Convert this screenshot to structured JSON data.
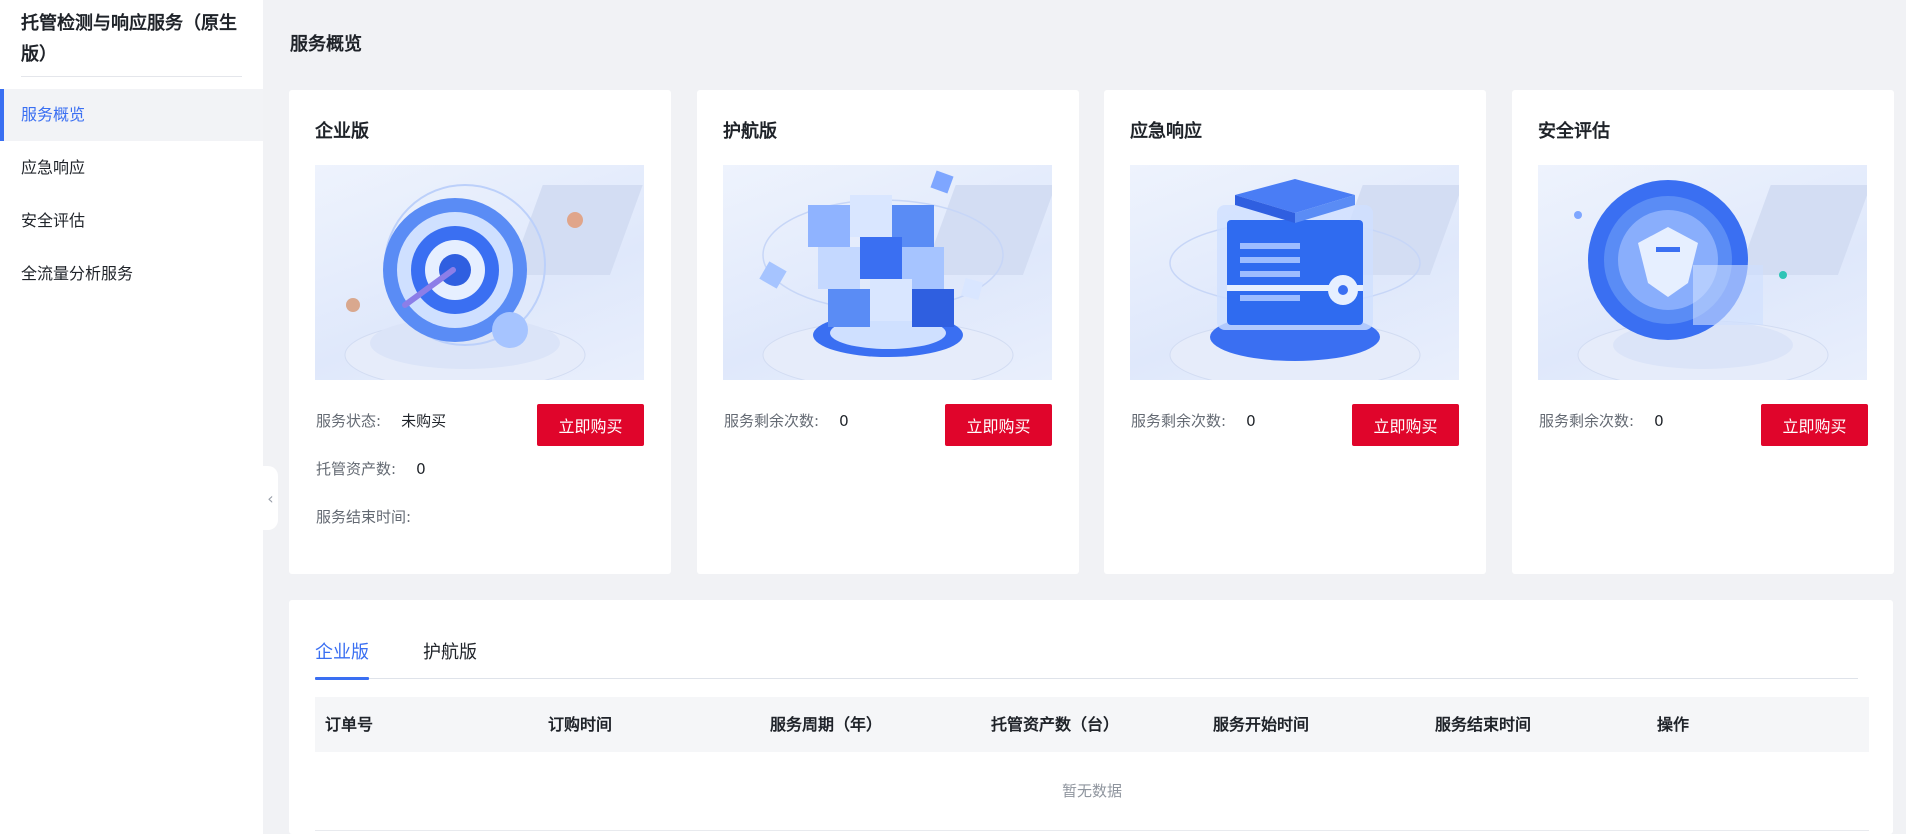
{
  "sidebar": {
    "title": "托管检测与响应服务（原生版）",
    "items": [
      {
        "label": "服务概览",
        "active": true
      },
      {
        "label": "应急响应",
        "active": false
      },
      {
        "label": "安全评估",
        "active": false
      },
      {
        "label": "全流量分析服务",
        "active": false
      }
    ],
    "collapse_icon": "chevron-left-icon"
  },
  "page": {
    "title": "服务概览"
  },
  "cards": [
    {
      "title": "企业版",
      "button": "立即购买",
      "image": "target-sphere-illustration",
      "info": [
        {
          "label": "服务状态:",
          "value": "未购买"
        },
        {
          "label": "托管资产数:",
          "value": "0"
        },
        {
          "label": "服务结束时间:",
          "value": ""
        }
      ]
    },
    {
      "title": "护航版",
      "button": "立即购买",
      "image": "cube-blocks-illustration",
      "info": [
        {
          "label": "服务剩余次数:",
          "value": "0"
        }
      ]
    },
    {
      "title": "应急响应",
      "button": "立即购买",
      "image": "server-box-illustration",
      "info": [
        {
          "label": "服务剩余次数:",
          "value": "0"
        }
      ]
    },
    {
      "title": "安全评估",
      "button": "立即购买",
      "image": "shield-orb-illustration",
      "info": [
        {
          "label": "服务剩余次数:",
          "value": "0"
        }
      ]
    }
  ],
  "orders": {
    "tabs": [
      {
        "label": "企业版",
        "active": true
      },
      {
        "label": "护航版",
        "active": false
      }
    ],
    "columns": [
      "订单号",
      "订购时间",
      "服务周期（年）",
      "托管资产数（台）",
      "服务开始时间",
      "服务结束时间",
      "操作"
    ],
    "empty_text": "暂无数据"
  },
  "colors": {
    "accent": "#3a6ff2",
    "buy_button": "#e0052b",
    "background": "#f1f2f5"
  }
}
